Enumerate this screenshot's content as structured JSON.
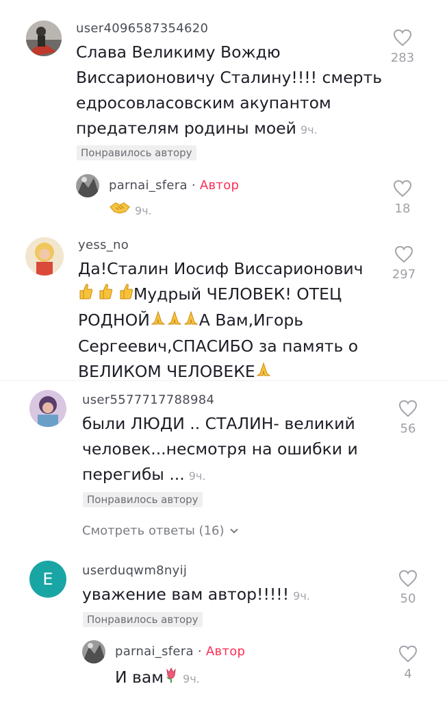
{
  "comments": [
    {
      "username": "user4096587354620",
      "lines": [
        "Слава Великиму Вождю",
        "Виссарионовичу Сталину!!!! смерть",
        "едросовласовским акупантом",
        "предателям родины моей"
      ],
      "time": "9ч.",
      "likes": "283",
      "badge": "Понравилось автору"
    },
    {
      "username": "yess_no",
      "line1": "Да!Сталин Иосиф Виссарионович",
      "line2": "Мудрый ЧЕЛОВЕК! ОТЕЦ",
      "line3a": "РОДНОЙ",
      "line3b": "А Вам,Игорь",
      "line4": "Сергеевич,СПАСИБО за память о",
      "line5": "ВЕЛИКОМ ЧЕЛОВЕКЕ",
      "likes": "297"
    },
    {
      "username": "user5577717788984",
      "lines": [
        "были ЛЮДИ .. СТАЛИН- великий",
        "человек...несмотря на ошибки и",
        "перегибы ..."
      ],
      "time": "9ч.",
      "likes": "56",
      "badge": "Понравилось автору",
      "view_replies": "Смотреть ответы (16)"
    },
    {
      "username": "userduqwm8nyij",
      "avatar_letter": "E",
      "text": "уважение вам автор!!!!!",
      "time": "9ч.",
      "likes": "50",
      "badge": "Понравилось автору"
    }
  ],
  "replies": [
    {
      "username": "parnai_sfera",
      "separator": "·",
      "author_label": "Автор",
      "time": "9ч.",
      "likes": "18"
    },
    {
      "username": "parnai_sfera",
      "separator": "·",
      "author_label": "Автор",
      "text": "И вам",
      "time": "9ч.",
      "likes": "4"
    }
  ],
  "colors": {
    "author_accent": "#fe2c55",
    "avatar_e": "#1aa5a5"
  }
}
